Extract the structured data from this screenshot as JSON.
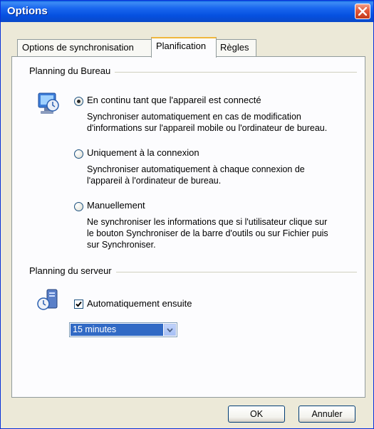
{
  "window": {
    "title": "Options"
  },
  "tabs": [
    {
      "label": "Options de synchronisation",
      "active": false
    },
    {
      "label": "Planification",
      "active": true
    },
    {
      "label": "Règles",
      "active": false
    }
  ],
  "desktop_schedule": {
    "group_label": "Planning du Bureau",
    "icon": "desktop-sync-icon",
    "options": [
      {
        "label": "En continu tant que l'appareil est connecté",
        "description": [
          "Synchroniser automatiquement en cas de modification",
          "d'informations sur l'appareil mobile ou l'ordinateur de bureau."
        ],
        "selected": true
      },
      {
        "label": "Uniquement à la connexion",
        "description": [
          "Synchroniser automatiquement à chaque connexion de",
          "l'appareil à l'ordinateur de bureau."
        ],
        "selected": false
      },
      {
        "label": "Manuellement",
        "description": [
          "Ne synchroniser les informations que si l'utilisateur clique sur",
          "le bouton Synchroniser de la barre d'outils ou sur Fichier puis",
          "sur Synchroniser."
        ],
        "selected": false
      }
    ]
  },
  "server_schedule": {
    "group_label": "Planning du serveur",
    "icon": "server-sync-icon",
    "checkbox_label": "Automatiquement ensuite",
    "checked": true,
    "interval_value": "15 minutes"
  },
  "buttons": {
    "ok_label": "OK",
    "cancel_label": "Annuler"
  },
  "colors": {
    "titlebar": "#0a5fe0",
    "selection": "#316ac5",
    "active_tab_accent": "#f0b73c"
  }
}
